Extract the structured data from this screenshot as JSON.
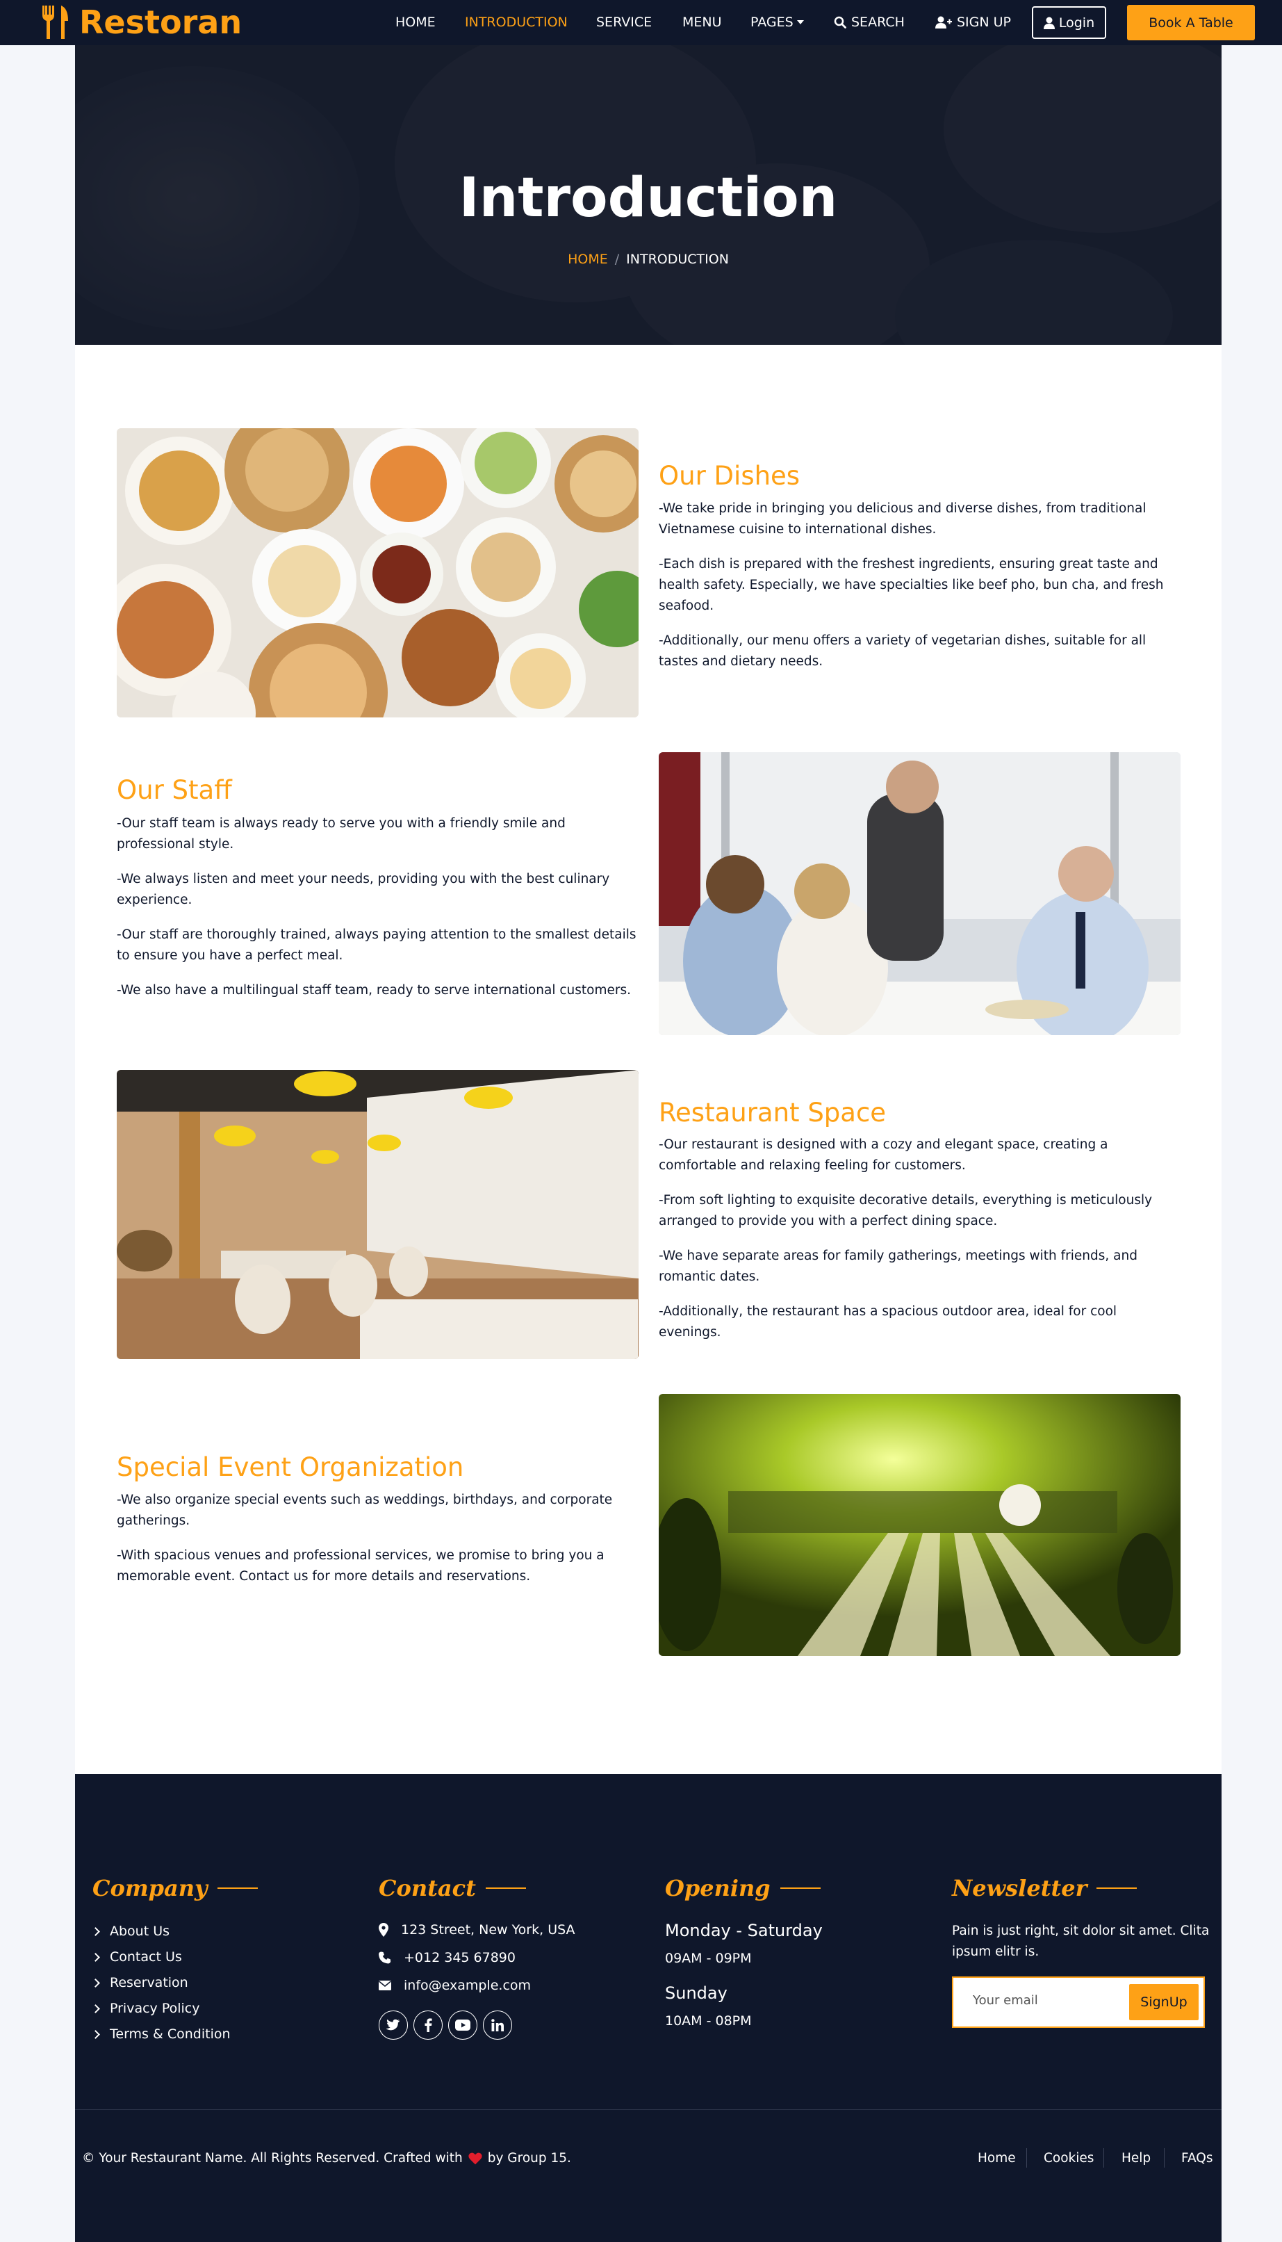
{
  "brand": {
    "name": "Restoran",
    "accent": "#fea116",
    "dark": "#0f172b"
  },
  "nav": {
    "items": [
      "HOME",
      "INTRODUCTION",
      "SERVICE",
      "MENU",
      "PAGES"
    ],
    "search": "SEARCH",
    "signup": "SIGN UP",
    "login": "Login",
    "book": "Book A Table",
    "active": "INTRODUCTION"
  },
  "hero": {
    "title": "Introduction",
    "breadcrumb_home": "HOME",
    "breadcrumb_sep": "/",
    "breadcrumb_current": "INTRODUCTION"
  },
  "sections": [
    {
      "title": "Our Dishes",
      "paragraphs": [
        "-We take pride in bringing you delicious and diverse dishes, from traditional Vietnamese cuisine to international dishes.",
        "-Each dish is prepared with the freshest ingredients, ensuring great taste and health safety. Especially, we have specialties like beef pho, bun cha, and fresh seafood.",
        "-Additionally, our menu offers a variety of vegetarian dishes, suitable for all tastes and dietary needs."
      ]
    },
    {
      "title": "Our Staff",
      "paragraphs": [
        "-Our staff team is always ready to serve you with a friendly smile and professional style.",
        "-We always listen and meet your needs, providing you with the best culinary experience.",
        "-Our staff are thoroughly trained, always paying attention to the smallest details to ensure you have a perfect meal.",
        "-We also have a multilingual staff team, ready to serve international customers."
      ]
    },
    {
      "title": "Restaurant Space",
      "paragraphs": [
        "-Our restaurant is designed with a cozy and elegant space, creating a comfortable and relaxing feeling for customers.",
        "-From soft lighting to exquisite decorative details, everything is meticulously arranged to provide you with a perfect dining space.",
        "-We have separate areas for family gatherings, meetings with friends, and romantic dates.",
        "-Additionally, the restaurant has a spacious outdoor area, ideal for cool evenings."
      ]
    },
    {
      "title": "Special Event Organization",
      "paragraphs": [
        "-We also organize special events such as weddings, birthdays, and corporate gatherings.",
        "-With spacious venues and professional services, we promise to bring you a memorable event. Contact us for more details and reservations."
      ]
    }
  ],
  "footer": {
    "company_title": "Company",
    "company_links": [
      "About Us",
      "Contact Us",
      "Reservation",
      "Privacy Policy",
      "Terms & Condition"
    ],
    "contact_title": "Contact",
    "contact": {
      "address": "123 Street, New York, USA",
      "phone": "+012 345 67890",
      "email": "info@example.com"
    },
    "social": [
      "twitter-icon",
      "facebook-icon",
      "youtube-icon",
      "linkedin-icon"
    ],
    "opening_title": "Opening",
    "opening": [
      {
        "days": "Monday - Saturday",
        "hours": "09AM - 09PM"
      },
      {
        "days": "Sunday",
        "hours": "10AM - 08PM"
      }
    ],
    "newsletter_title": "Newsletter",
    "newsletter_text": "Pain is just right, sit dolor sit amet. Clita ipsum elitr is.",
    "newsletter_placeholder": "Your email",
    "newsletter_button": "SignUp",
    "copyright_before": "© Your Restaurant Name. All Rights Reserved. Crafted with",
    "copyright_after": "by Group 15.",
    "bottom_links": [
      "Home",
      "Cookies",
      "Help",
      "FAQs"
    ]
  }
}
